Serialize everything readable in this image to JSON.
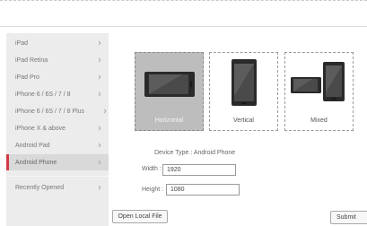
{
  "sidebar": {
    "items": [
      {
        "label": "iPad"
      },
      {
        "label": "iPad Retina"
      },
      {
        "label": "iPad Pro"
      },
      {
        "label": "iPhone 6 / 6S / 7 / 8"
      },
      {
        "label": "iPhone 6 / 6S / 7 / 8 Plus"
      },
      {
        "label": "iPhone X & above"
      },
      {
        "label": "Android Pad"
      },
      {
        "label": "Android Phone"
      },
      {
        "label": "Recently Opened"
      }
    ],
    "active_index": 7,
    "accent_color": "#d23b46"
  },
  "orientations": {
    "horizontal": {
      "label": "Horizontal",
      "selected": true
    },
    "vertical": {
      "label": "Vertical",
      "selected": false
    },
    "mixed": {
      "label": "Mixed",
      "selected": false
    }
  },
  "device": {
    "type_label": "Device Type :",
    "type_value": "Android Phone",
    "width_label": "Width :",
    "width_value": "1920",
    "height_label": "Height :",
    "height_value": "1080"
  },
  "footer": {
    "open_local_file_label": "Open Local File",
    "submit_label": "Submit"
  },
  "icons": {
    "chevron": "chevron-right-icon",
    "phone": "phone-icon"
  }
}
